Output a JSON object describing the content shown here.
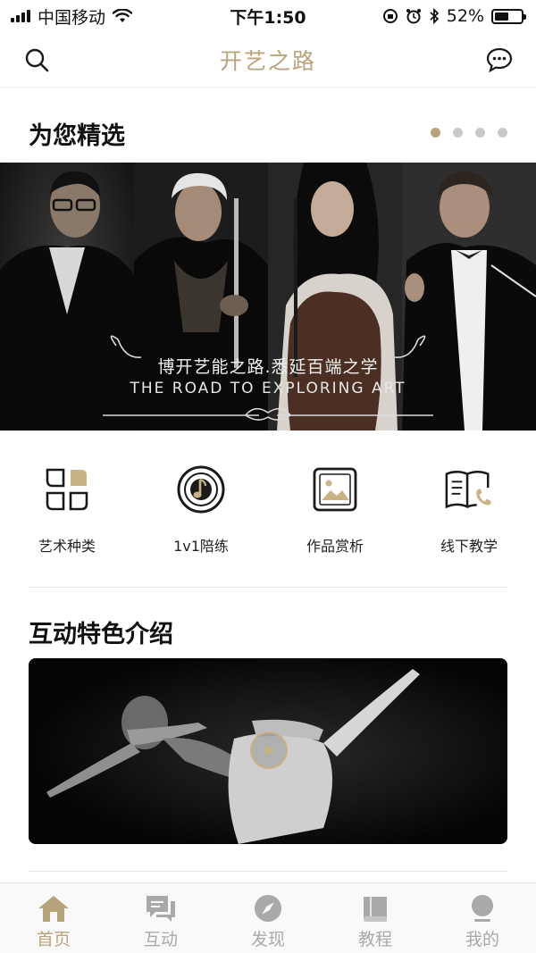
{
  "status_bar": {
    "carrier": "中国移动",
    "time": "下午1:50",
    "battery": "52%",
    "battery_level": 0.52
  },
  "header": {
    "title": "开艺之路",
    "search_icon": "search-icon",
    "message_icon": "chat-bubble-icon"
  },
  "featured": {
    "title": "为您精选",
    "carousel_pages": 4,
    "active_page": 1,
    "banner_cn": "博开艺能之路.悉延百端之学",
    "banner_en": "THE ROAD TO EXPLORING ART"
  },
  "categories": [
    {
      "label": "艺术种类",
      "icon": "four-petal-grid-icon"
    },
    {
      "label": "1v1陪练",
      "icon": "music-disc-icon"
    },
    {
      "label": "作品赏析",
      "icon": "picture-frame-icon"
    },
    {
      "label": "线下教学",
      "icon": "open-book-phone-icon"
    }
  ],
  "interactive": {
    "title": "互动特色介绍",
    "video_icon": "play-icon"
  },
  "tabs": [
    {
      "label": "首页",
      "icon": "home-icon",
      "active": true
    },
    {
      "label": "互动",
      "icon": "chat-icon",
      "active": false
    },
    {
      "label": "发现",
      "icon": "compass-icon",
      "active": false
    },
    {
      "label": "教程",
      "icon": "book-icon",
      "active": false
    },
    {
      "label": "我的",
      "icon": "user-icon",
      "active": false
    }
  ],
  "colors": {
    "accent": "#b8a47a",
    "inactive": "#a9a9a9",
    "text": "#1a1a1a"
  }
}
